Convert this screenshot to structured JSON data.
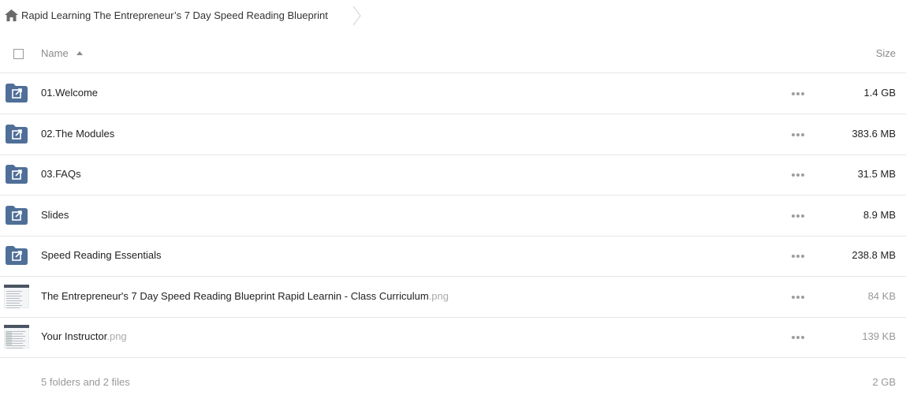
{
  "breadcrumb": {
    "title": "Rapid Learning The Entrepreneur’s 7 Day Speed Reading Blueprint"
  },
  "header": {
    "name_label": "Name",
    "size_label": "Size",
    "sort": "ascending"
  },
  "colors": {
    "folder": "#4f6f98",
    "text": "#222222",
    "muted": "#999999",
    "divider": "#e6e6e6"
  },
  "items": [
    {
      "type": "folder",
      "name": "01.Welcome",
      "ext": "",
      "size": "1.4 GB",
      "icon": "shared-folder-icon"
    },
    {
      "type": "folder",
      "name": "02.The Modules",
      "ext": "",
      "size": "383.6 MB",
      "icon": "shared-folder-icon"
    },
    {
      "type": "folder",
      "name": "03.FAQs",
      "ext": "",
      "size": "31.5 MB",
      "icon": "shared-folder-icon"
    },
    {
      "type": "folder",
      "name": "Slides",
      "ext": "",
      "size": "8.9 MB",
      "icon": "shared-folder-icon"
    },
    {
      "type": "folder",
      "name": "Speed Reading Essentials",
      "ext": "",
      "size": "238.8 MB",
      "icon": "shared-folder-icon"
    },
    {
      "type": "file",
      "name": "The Entrepreneur's 7 Day Speed Reading Blueprint Rapid Learnin - Class Curriculum",
      "ext": ".png",
      "size": "84 KB",
      "icon": "image-thumbnail"
    },
    {
      "type": "file",
      "name": "Your Instructor",
      "ext": ".png",
      "size": "139 KB",
      "icon": "image-thumbnail"
    }
  ],
  "footer": {
    "summary": "5 folders and 2 files",
    "total": "2 GB"
  }
}
